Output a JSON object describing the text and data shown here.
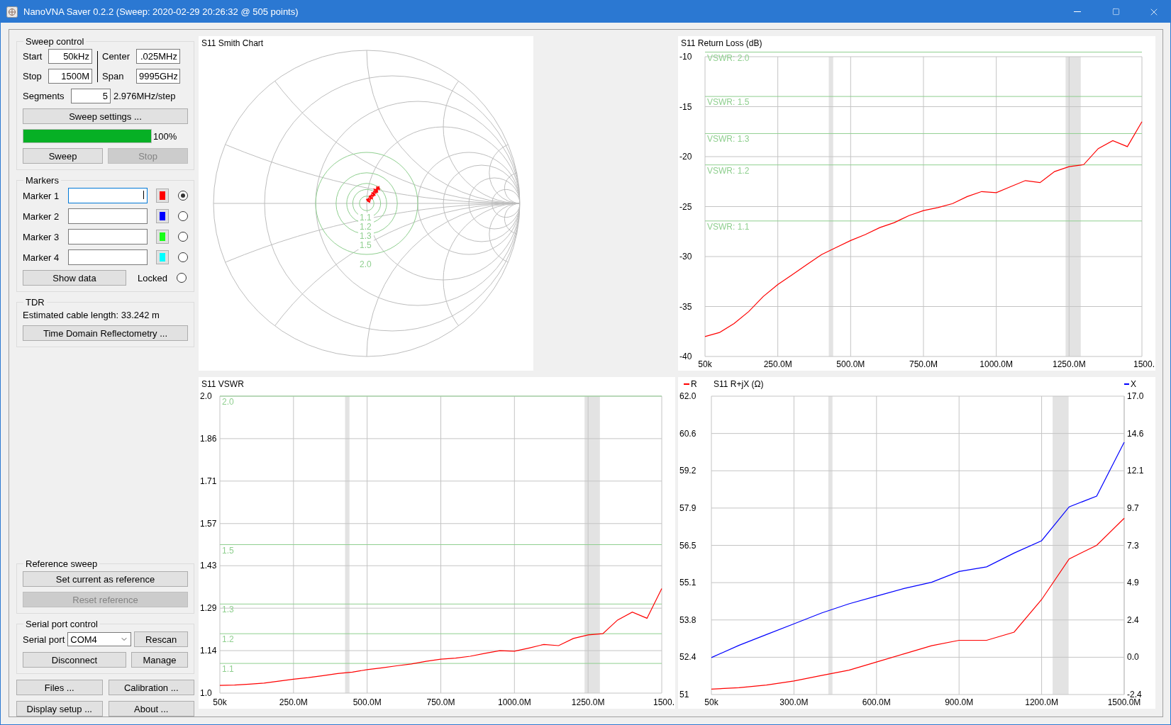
{
  "window": {
    "title": "NanoVNA Saver 0.2.2 (Sweep: 2020-02-29 20:26:32 @ 505 points)"
  },
  "sweep_control": {
    "title": "Sweep control",
    "fields": [
      {
        "label": "Start",
        "value": "50kHz"
      },
      {
        "label": "Center",
        "value": ".025MHz"
      },
      {
        "label": "Stop",
        "value": "1500M"
      },
      {
        "label": "Span",
        "value": "9995GHz"
      }
    ],
    "segments": {
      "label": "Segments",
      "value": "5",
      "step": "2.976MHz/step"
    },
    "settings_button": "Sweep settings ...",
    "progress": {
      "level": 1.0,
      "text": "100%"
    },
    "buttons": [
      {
        "label": "Sweep",
        "disabled": false
      },
      {
        "label": "Stop",
        "disabled": true
      }
    ]
  },
  "markers": {
    "title": "Markers",
    "items": [
      {
        "label": "Marker 1",
        "color": "#ff0000",
        "selected": true,
        "focused": true
      },
      {
        "label": "Marker 2",
        "color": "#0000ff",
        "selected": false,
        "focused": false
      },
      {
        "label": "Marker 3",
        "color": "#18ff18",
        "selected": false,
        "focused": false
      },
      {
        "label": "Marker 4",
        "color": "#00ffff",
        "selected": false,
        "focused": false
      }
    ],
    "show_data_button": "Show data",
    "locked": {
      "label": "Locked",
      "checked": false
    }
  },
  "tdr": {
    "title": "TDR",
    "cable_length": "Estimated cable length: 33.242 m",
    "button": "Time Domain Reflectometry ..."
  },
  "reference_sweep": {
    "title": "Reference sweep",
    "buttons": [
      {
        "label": "Set current as reference",
        "disabled": false
      },
      {
        "label": "Reset reference",
        "disabled": true
      }
    ]
  },
  "serial_port": {
    "title": "Serial port control",
    "label": "Serial port",
    "port": "COM4",
    "buttons": [
      "Rescan",
      "Disconnect",
      "Manage"
    ]
  },
  "bottom_buttons": [
    "Files ...",
    "Calibration ...",
    "Display setup ...",
    "About ..."
  ],
  "smith_chart": {
    "title": "S11 Smith Chart",
    "vswr_circles": [
      {
        "label": "1.1"
      },
      {
        "label": "1.2"
      },
      {
        "label": "1.3"
      },
      {
        "label": "1.5"
      },
      {
        "label": "2.0"
      }
    ]
  },
  "return_loss_chart": {
    "chart_data": {
      "type": "line",
      "title": "S11 Return Loss (dB)",
      "x": [
        50000,
        50000000,
        100000000,
        150000000,
        200000000,
        250000000,
        300000000,
        350000000,
        400000000,
        450000000,
        500000000,
        550000000,
        600000000,
        650000000,
        700000000,
        750000000,
        800000000,
        850000000,
        900000000,
        950000000,
        1000000000,
        1050000000,
        1100000000,
        1150000000,
        1200000000,
        1250000000,
        1300000000,
        1350000000,
        1400000000,
        1450000000,
        1500000000
      ],
      "series": [
        {
          "color": "#ff0000",
          "values": [
            -38.0,
            -37.6,
            -36.7,
            -35.5,
            -34.0,
            -32.8,
            -31.8,
            -30.8,
            -29.8,
            -29.1,
            -28.4,
            -27.8,
            -27.1,
            -26.6,
            -25.9,
            -25.4,
            -25.1,
            -24.7,
            -24.0,
            -23.5,
            -23.6,
            -23.0,
            -22.4,
            -22.6,
            -21.5,
            -21.0,
            -20.8,
            -19.2,
            -18.4,
            -19.0,
            -16.5
          ]
        }
      ],
      "xlim": [
        50000,
        1500000000
      ],
      "ylim": [
        -40,
        -10
      ],
      "xticks": [
        {
          "value": 50000,
          "label": "50k"
        },
        {
          "value": 250000000,
          "label": "250.0M"
        },
        {
          "value": 500000000,
          "label": "500.0M"
        },
        {
          "value": 750000000,
          "label": "750.0M"
        },
        {
          "value": 1000000000,
          "label": "1000.0M"
        },
        {
          "value": 1250000000,
          "label": "1250.0M"
        }
      ],
      "yticks": [
        -10,
        -15,
        -20,
        -25,
        -30,
        -35,
        -40
      ],
      "grid": true,
      "ref_lines": [
        {
          "axis": "y",
          "value": -9.54
        },
        {
          "axis": "y",
          "value": -13.98
        },
        {
          "axis": "y",
          "value": -17.69
        },
        {
          "axis": "y",
          "value": -20.83
        },
        {
          "axis": "y",
          "value": -26.44
        }
      ],
      "bands": [
        {
          "axis": "x",
          "from": 425000000,
          "to": 440000000
        },
        {
          "axis": "x",
          "from": 1238000000,
          "to": 1290000000
        }
      ]
    },
    "ref_line_labels": [
      "VSWR: 2.0",
      "VSWR: 1.5",
      "VSWR: 1.3",
      "VSWR: 1.2",
      "VSWR: 1.1"
    ],
    "edge_label": "1500."
  },
  "vswr_chart": {
    "chart_data": {
      "type": "line",
      "title": "S11 VSWR",
      "x": [
        50000,
        50000000,
        100000000,
        150000000,
        200000000,
        250000000,
        300000000,
        350000000,
        400000000,
        450000000,
        500000000,
        550000000,
        600000000,
        650000000,
        700000000,
        750000000,
        800000000,
        850000000,
        900000000,
        950000000,
        1000000000,
        1050000000,
        1100000000,
        1150000000,
        1200000000,
        1250000000,
        1300000000,
        1350000000,
        1400000000,
        1450000000,
        1500000000
      ],
      "series": [
        {
          "color": "#ff0000",
          "values": [
            1.026,
            1.027,
            1.03,
            1.034,
            1.04,
            1.047,
            1.052,
            1.059,
            1.066,
            1.071,
            1.079,
            1.085,
            1.092,
            1.098,
            1.107,
            1.114,
            1.118,
            1.124,
            1.134,
            1.143,
            1.141,
            1.152,
            1.164,
            1.16,
            1.184,
            1.196,
            1.2,
            1.246,
            1.273,
            1.252,
            1.352
          ]
        }
      ],
      "xlim": [
        50000,
        1500000000
      ],
      "ylim": [
        1.0,
        2.0
      ],
      "xticks": [
        {
          "value": 50000,
          "label": "50k"
        },
        {
          "value": 250000000,
          "label": "250.0M"
        },
        {
          "value": 500000000,
          "label": "500.0M"
        },
        {
          "value": 750000000,
          "label": "750.0M"
        },
        {
          "value": 1000000000,
          "label": "1000.0M"
        },
        {
          "value": 1250000000,
          "label": "1250.0M"
        }
      ],
      "yticks": [
        {
          "value": 1.0,
          "label": "1.0"
        },
        {
          "value": 1.143,
          "label": "1.14"
        },
        {
          "value": 1.286,
          "label": "1.29"
        },
        {
          "value": 1.429,
          "label": "1.43"
        },
        {
          "value": 1.571,
          "label": "1.57"
        },
        {
          "value": 1.714,
          "label": "1.71"
        },
        {
          "value": 1.857,
          "label": "1.86"
        },
        {
          "value": 2.0,
          "label": "2.0"
        }
      ],
      "grid": true,
      "ref_lines": [
        {
          "axis": "y",
          "value": 2.0,
          "label": "2.0"
        },
        {
          "axis": "y",
          "value": 1.5,
          "label": "1.5"
        },
        {
          "axis": "y",
          "value": 1.3,
          "label": "1.3"
        },
        {
          "axis": "y",
          "value": 1.2,
          "label": "1.2"
        },
        {
          "axis": "y",
          "value": 1.1,
          "label": "1.1"
        }
      ],
      "bands": [
        {
          "axis": "x",
          "from": 425000000,
          "to": 440000000
        },
        {
          "axis": "x",
          "from": 1238000000,
          "to": 1290000000
        }
      ]
    },
    "edge_label": "1500."
  },
  "impedance_chart": {
    "chart_data": {
      "type": "line",
      "title": "S11 R+jX (Ω)",
      "x": [
        50000,
        100000000,
        200000000,
        300000000,
        400000000,
        500000000,
        600000000,
        700000000,
        800000000,
        900000000,
        1000000000,
        1100000000,
        1200000000,
        1300000000,
        1400000000,
        1500000000
      ],
      "series": [
        {
          "name": "R",
          "color": "#ff0000",
          "values": [
            51.2,
            51.25,
            51.35,
            51.5,
            51.7,
            51.9,
            52.2,
            52.5,
            52.8,
            53.0,
            53.0,
            53.3,
            54.5,
            56.0,
            56.5,
            57.5
          ]
        },
        {
          "name": "X",
          "color": "#0000ff",
          "axis": "y2",
          "values": [
            0.0,
            0.8,
            1.5,
            2.2,
            2.9,
            3.5,
            4.0,
            4.5,
            4.9,
            5.6,
            5.9,
            6.8,
            7.6,
            9.8,
            10.5,
            14.0
          ]
        }
      ],
      "xlim": [
        50000,
        1500000000
      ],
      "ylim": [
        51,
        62
      ],
      "y2lim": [
        -2.4,
        17.0
      ],
      "xticks": [
        {
          "value": 50000,
          "label": "50k"
        },
        {
          "value": 300000000,
          "label": "300.0M"
        },
        {
          "value": 600000000,
          "label": "600.0M"
        },
        {
          "value": 900000000,
          "label": "900.0M"
        },
        {
          "value": 1200000000,
          "label": "1200.0M"
        },
        {
          "value": 1500000000,
          "label": "1500.0M"
        }
      ],
      "yticks": [
        {
          "value": 51,
          "label": "51"
        },
        {
          "value": 52.375,
          "label": "52.4"
        },
        {
          "value": 53.75,
          "label": "53.8"
        },
        {
          "value": 55.125,
          "label": "55.1"
        },
        {
          "value": 56.5,
          "label": "56.5"
        },
        {
          "value": 57.875,
          "label": "57.9"
        },
        {
          "value": 59.25,
          "label": "59.2"
        },
        {
          "value": 60.625,
          "label": "60.6"
        },
        {
          "value": 62,
          "label": "62.0"
        }
      ],
      "y2ticks": [
        {
          "value": -2.4,
          "label": "-2.4"
        },
        {
          "value": 0.025,
          "label": "0.0"
        },
        {
          "value": 2.45,
          "label": "2.4"
        },
        {
          "value": 4.875,
          "label": "4.9"
        },
        {
          "value": 7.3,
          "label": "7.3"
        },
        {
          "value": 9.725,
          "label": "9.7"
        },
        {
          "value": 12.15,
          "label": "12.1"
        },
        {
          "value": 14.575,
          "label": "14.6"
        },
        {
          "value": 17.0,
          "label": "17.0"
        }
      ],
      "grid": true,
      "legend": "top",
      "bands": [
        {
          "axis": "x",
          "from": 425000000,
          "to": 440000000
        },
        {
          "axis": "x",
          "from": 1240000000,
          "to": 1298000000
        }
      ]
    }
  }
}
